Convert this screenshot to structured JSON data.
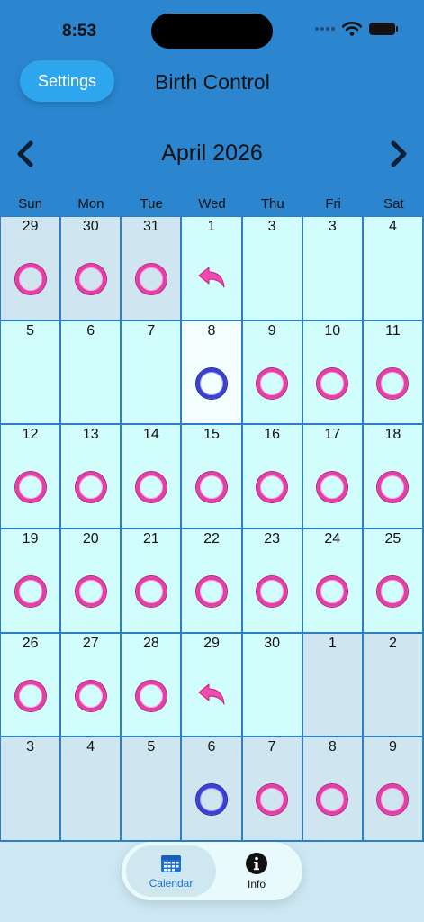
{
  "status": {
    "time": "8:53"
  },
  "header": {
    "settings_label": "Settings",
    "title": "Birth Control"
  },
  "calendar": {
    "month_title": "April 2026",
    "weekdays": [
      "Sun",
      "Mon",
      "Tue",
      "Wed",
      "Thu",
      "Fri",
      "Sat"
    ],
    "days": [
      {
        "n": "29",
        "mark": "pink",
        "other": true
      },
      {
        "n": "30",
        "mark": "pink",
        "other": true
      },
      {
        "n": "31",
        "mark": "pink",
        "other": true
      },
      {
        "n": "1",
        "mark": "arrow"
      },
      {
        "n": "3",
        "mark": ""
      },
      {
        "n": "3",
        "mark": ""
      },
      {
        "n": "4",
        "mark": ""
      },
      {
        "n": "5",
        "mark": ""
      },
      {
        "n": "6",
        "mark": ""
      },
      {
        "n": "7",
        "mark": ""
      },
      {
        "n": "8",
        "mark": "blue",
        "today": true
      },
      {
        "n": "9",
        "mark": "pink"
      },
      {
        "n": "10",
        "mark": "pink"
      },
      {
        "n": "11",
        "mark": "pink"
      },
      {
        "n": "12",
        "mark": "pink"
      },
      {
        "n": "13",
        "mark": "pink"
      },
      {
        "n": "14",
        "mark": "pink"
      },
      {
        "n": "15",
        "mark": "pink"
      },
      {
        "n": "16",
        "mark": "pink"
      },
      {
        "n": "17",
        "mark": "pink"
      },
      {
        "n": "18",
        "mark": "pink"
      },
      {
        "n": "19",
        "mark": "pink"
      },
      {
        "n": "20",
        "mark": "pink"
      },
      {
        "n": "21",
        "mark": "pink"
      },
      {
        "n": "22",
        "mark": "pink"
      },
      {
        "n": "23",
        "mark": "pink"
      },
      {
        "n": "24",
        "mark": "pink"
      },
      {
        "n": "25",
        "mark": "pink"
      },
      {
        "n": "26",
        "mark": "pink"
      },
      {
        "n": "27",
        "mark": "pink"
      },
      {
        "n": "28",
        "mark": "pink"
      },
      {
        "n": "29",
        "mark": "arrow"
      },
      {
        "n": "30",
        "mark": ""
      },
      {
        "n": "1",
        "mark": "",
        "other": true
      },
      {
        "n": "2",
        "mark": "",
        "other": true
      },
      {
        "n": "3",
        "mark": "",
        "other": true
      },
      {
        "n": "4",
        "mark": "",
        "other": true
      },
      {
        "n": "5",
        "mark": "",
        "other": true
      },
      {
        "n": "6",
        "mark": "blue",
        "other": true
      },
      {
        "n": "7",
        "mark": "pink",
        "other": true
      },
      {
        "n": "8",
        "mark": "pink",
        "other": true
      },
      {
        "n": "9",
        "mark": "pink",
        "other": true
      }
    ]
  },
  "tabs": [
    {
      "label": "Calendar",
      "icon": "calendar-icon",
      "selected": true
    },
    {
      "label": "Info",
      "icon": "info-icon",
      "selected": false
    }
  ],
  "colors": {
    "header_bg": "#2b86cf",
    "cell_bg": "#d2fdfd",
    "pink_ring": "#e43fa9",
    "blue_ring": "#3b3fd6",
    "accent": "#1f6fd0"
  }
}
